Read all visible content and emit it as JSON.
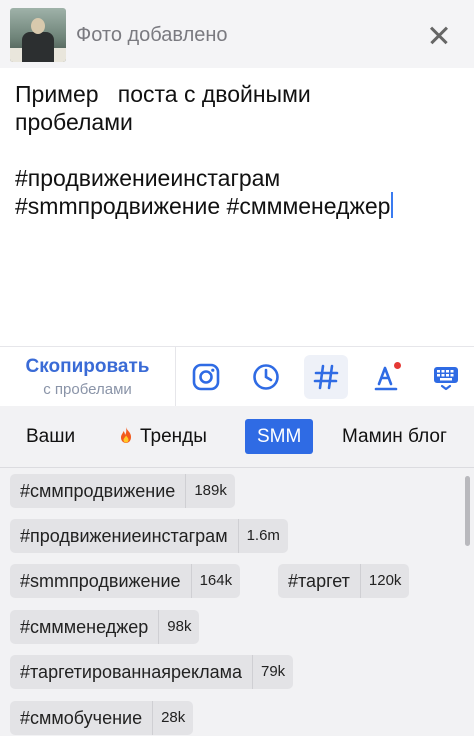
{
  "notification": {
    "title": "Фото добавлено"
  },
  "post": {
    "text": "Пример   поста с двойными\nпробелами\n\n#продвижениеинстаграм\n#smmпродвижение #сммменеджер"
  },
  "toolbar": {
    "copy_label": "Скопировать",
    "copy_sublabel": "с пробелами",
    "tools": [
      "instagram-icon",
      "clock-icon",
      "hashtag-icon",
      "font-icon",
      "keyboard-icon"
    ],
    "active_tool": "hashtag-icon"
  },
  "tabs": {
    "items": [
      "Ваши",
      "Тренды",
      "SMM",
      "Мамин блог"
    ],
    "selected": "SMM"
  },
  "hashtags": [
    {
      "tag": "#сммпродвижение",
      "count": "189k"
    },
    {
      "tag": "#продвижениеинстаграм",
      "count": "1.6m"
    },
    {
      "tag": "#smmпродвижение",
      "count": "164k"
    },
    {
      "tag": "#таргет",
      "count": "120k"
    },
    {
      "tag": "#сммменеджер",
      "count": "98k"
    },
    {
      "tag": "#таргетированнаяреклама",
      "count": "79k"
    },
    {
      "tag": "#сммобучение",
      "count": "28k"
    }
  ],
  "colors": {
    "accent": "#2f6be4",
    "copy_text": "#3a6bd6",
    "notification_dot": "#e53935"
  }
}
